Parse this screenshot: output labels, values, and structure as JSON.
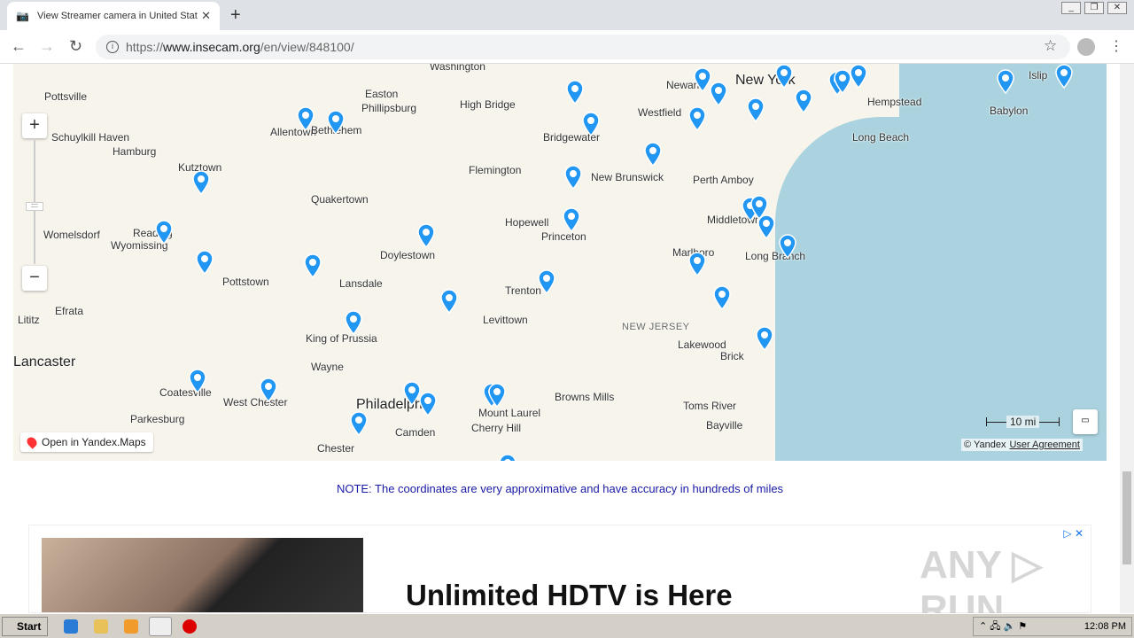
{
  "browser": {
    "tab_title": "View Streamer camera in United Stat",
    "url_scheme": "https://",
    "url_host": "www.insecam.org",
    "url_path": "/en/view/848100/",
    "new_tab": "+",
    "close": "✕"
  },
  "map": {
    "labels": [
      "Washington",
      "Pottsville",
      "Easton",
      "Phillipsburg",
      "High Bridge",
      "Allentown",
      "Bethlehem",
      "Schuylkill Haven",
      "Hamburg",
      "Kutztown",
      "Flemington",
      "Bridgewater",
      "Westfield",
      "Newark",
      "New York",
      "Hempstead",
      "Islip",
      "Babylon",
      "Long Beach",
      "Quakertown",
      "New Brunswick",
      "Perth Amboy",
      "Hopewell",
      "Princeton",
      "Middletown",
      "Womelsdorf",
      "Reading",
      "Wyomissing",
      "Doylestown",
      "Marlboro",
      "Long Branch",
      "Pottstown",
      "Lansdale",
      "Trenton",
      "Lititz",
      "Efrata",
      "Levittown",
      "NEW JERSEY",
      "King of Prussia",
      "Lakewood",
      "Brick",
      "Wayne",
      "Lancaster",
      "Coatesville",
      "West Chester",
      "Philadelphia",
      "Mount Laurel",
      "Browns Mills",
      "Toms River",
      "Camden",
      "Cherry Hill",
      "Bayville",
      "Parkesburg",
      "Chester"
    ],
    "zoom_in": "+",
    "zoom_out": "−",
    "open_link": "Open in Yandex.Maps",
    "scale": "10 mi",
    "copyright": "© Yandex",
    "user_agreement": "User Agreement",
    "marker_color": "#2196f3"
  },
  "note": "NOTE: The coordinates are very approximative and have accuracy in hundreds of miles",
  "ad": {
    "headline": "Unlimited HDTV is Here",
    "choices": "▷ ✕"
  },
  "watermark": "ANY ▷ RUN",
  "taskbar": {
    "start": "Start",
    "clock": "12:08 PM"
  }
}
